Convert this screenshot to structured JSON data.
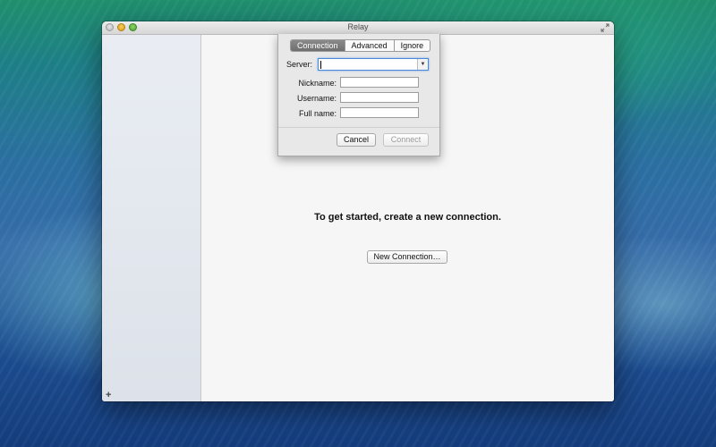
{
  "window": {
    "title": "Relay"
  },
  "main": {
    "headline": "To get started, create a new connection.",
    "new_connection_label": "New Connection…"
  },
  "sidebar": {
    "add_symbol": "+"
  },
  "sheet": {
    "tabs": [
      {
        "label": "Connection",
        "active": true
      },
      {
        "label": "Advanced",
        "active": false
      },
      {
        "label": "Ignore",
        "active": false
      }
    ],
    "server_label": "Server:",
    "server_value": "",
    "nickname_label": "Nickname:",
    "username_label": "Username:",
    "fullname_label": "Full name:",
    "cancel_label": "Cancel",
    "connect_label": "Connect"
  },
  "icons": {
    "close": "close-icon",
    "minimize": "minimize-icon",
    "zoom": "zoom-icon",
    "fullscreen": "fullscreen-icon",
    "dropdown": "chevron-down-icon",
    "add": "add-icon"
  },
  "colors": {
    "focus_ring": "#4a8ad8",
    "tab_active": "#7b7b7b"
  }
}
